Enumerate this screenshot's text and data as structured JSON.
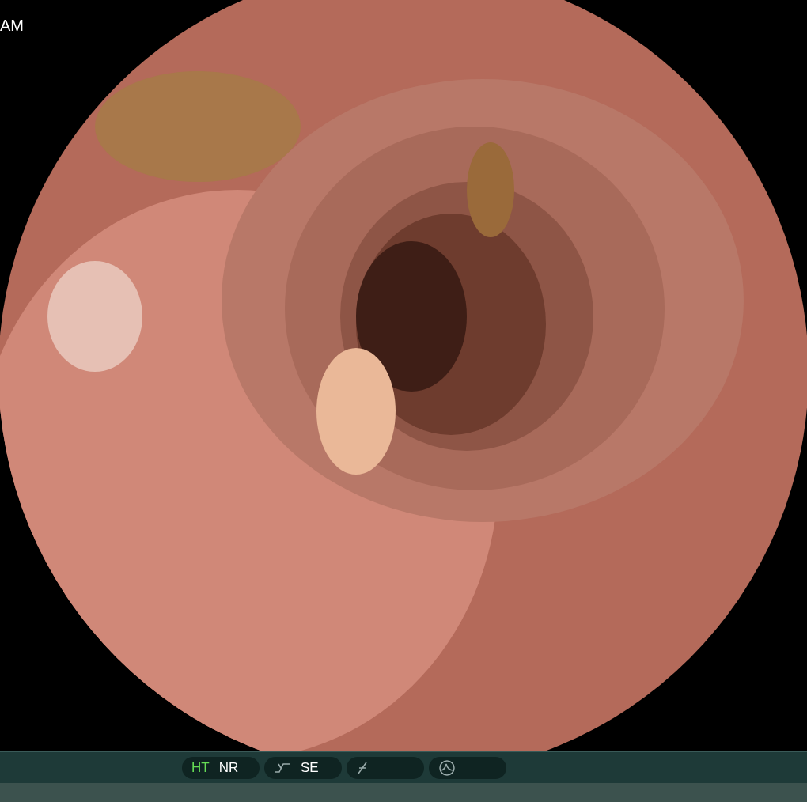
{
  "video": {
    "kind": "picture",
    "corner_text": "AM"
  },
  "status_bar": {
    "groups": [
      {
        "kind": "labels",
        "items": [
          {
            "label": "HT",
            "highlighted": true
          },
          {
            "label": "NR",
            "highlighted": false
          }
        ]
      },
      {
        "kind": "curve",
        "items": [
          {
            "label": "SE",
            "highlighted": false
          }
        ]
      },
      {
        "kind": "slash"
      },
      {
        "kind": "peak"
      }
    ]
  }
}
